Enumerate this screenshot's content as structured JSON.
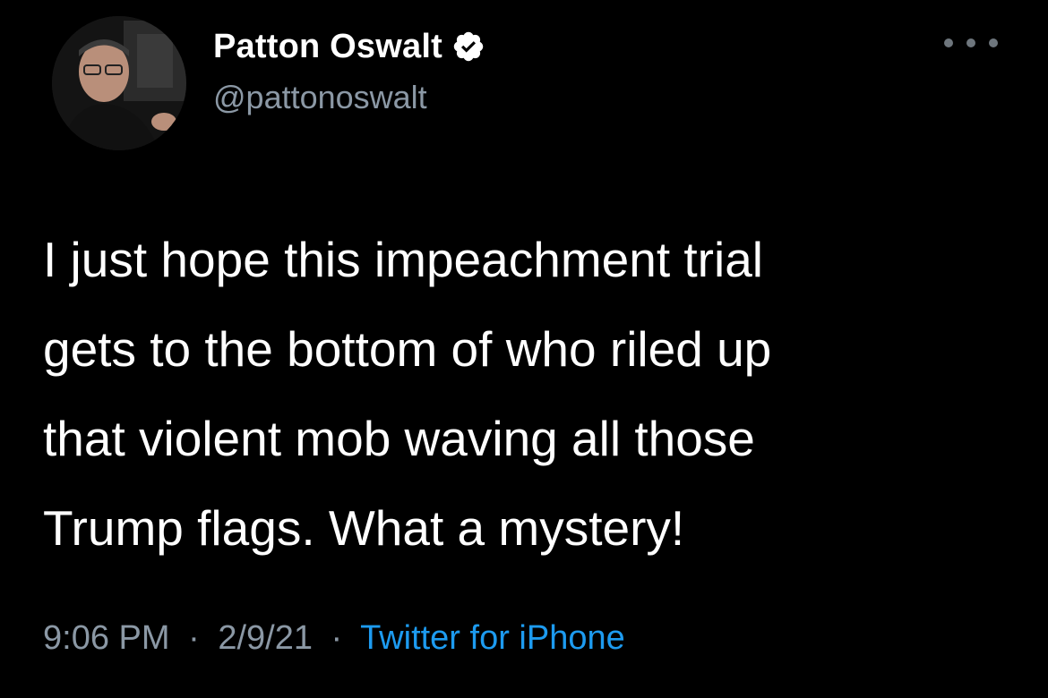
{
  "tweet": {
    "author": {
      "display_name": "Patton Oswalt",
      "handle": "@pattonoswalt",
      "verified_icon": "verified-badge-icon",
      "avatar_icon": "avatar-photo"
    },
    "text_lines": [
      "I just hope this impeachment trial",
      "gets to the bottom of who riled up",
      "that violent mob waving all those",
      "Trump flags. What a mystery!"
    ],
    "time": "9:06 PM",
    "date": "2/9/21",
    "separator": "·",
    "source": "Twitter for iPhone",
    "more_icon": "more-options-icon"
  },
  "colors": {
    "background": "#000000",
    "text": "#ffffff",
    "secondary_text": "#8b98a5",
    "link": "#1d9bf0"
  }
}
